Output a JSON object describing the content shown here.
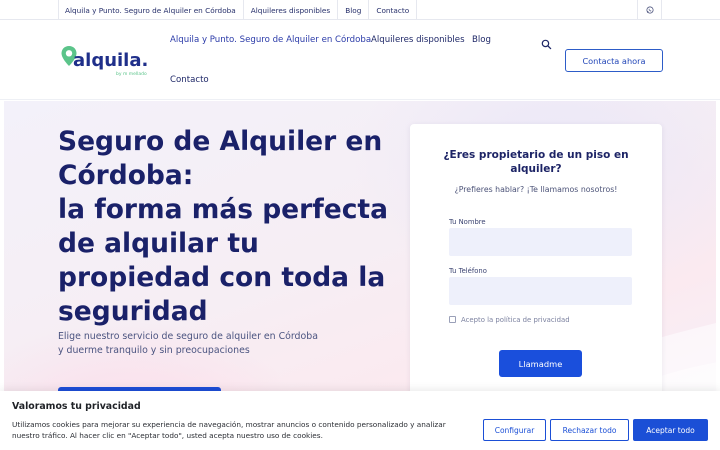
{
  "topbar": {
    "links": [
      "Alquila y Punto. Seguro de Alquiler en Córdoba",
      "Alquileres disponibles",
      "Blog",
      "Contacto"
    ],
    "whatsapp_icon": "whatsapp-icon"
  },
  "header": {
    "logo": {
      "brand": "alquila.",
      "tagline": "by m mellado"
    },
    "nav": [
      "Alquila y Punto. Seguro de Alquiler en Córdoba",
      "Alquileres disponibles",
      "Blog",
      "Contacto"
    ],
    "search_icon": "search-icon",
    "cta_label": "Contacta ahora"
  },
  "hero": {
    "title_lines": [
      "Seguro de Alquiler en",
      "Córdoba:",
      "la forma más perfecta",
      "de alquilar tu",
      "propiedad con toda la",
      "seguridad"
    ],
    "subtitle_lines": [
      "Elige nuestro servicio de seguro de alquiler en Córdoba",
      "y duerme tranquilo y sin preocupaciones"
    ]
  },
  "form": {
    "title": "¿Eres propietario de un piso en alquiler?",
    "subtitle": "¿Prefieres hablar? ¡Te llamamos nosotros!",
    "name_label": "Tu Nombre",
    "name_value": "",
    "phone_label": "Tu Teléfono",
    "phone_value": "",
    "privacy_label": "Acepto la política de privacidad",
    "submit_label": "Llamadme"
  },
  "cookies": {
    "title": "Valoramos tu privacidad",
    "text": "Utilizamos cookies para mejorar su experiencia de navegación, mostrar anuncios o contenido personalizado y analizar nuestro tráfico. Al hacer clic en \"Aceptar todo\", usted acepta nuestro uso de cookies.",
    "configure_label": "Configurar",
    "reject_label": "Rechazar todo",
    "accept_label": "Aceptar todo"
  },
  "colors": {
    "brand_blue": "#1b4fd6",
    "heading_navy": "#1a2169",
    "logo_green": "#5bc48a",
    "logo_navy": "#1f2f8a"
  }
}
